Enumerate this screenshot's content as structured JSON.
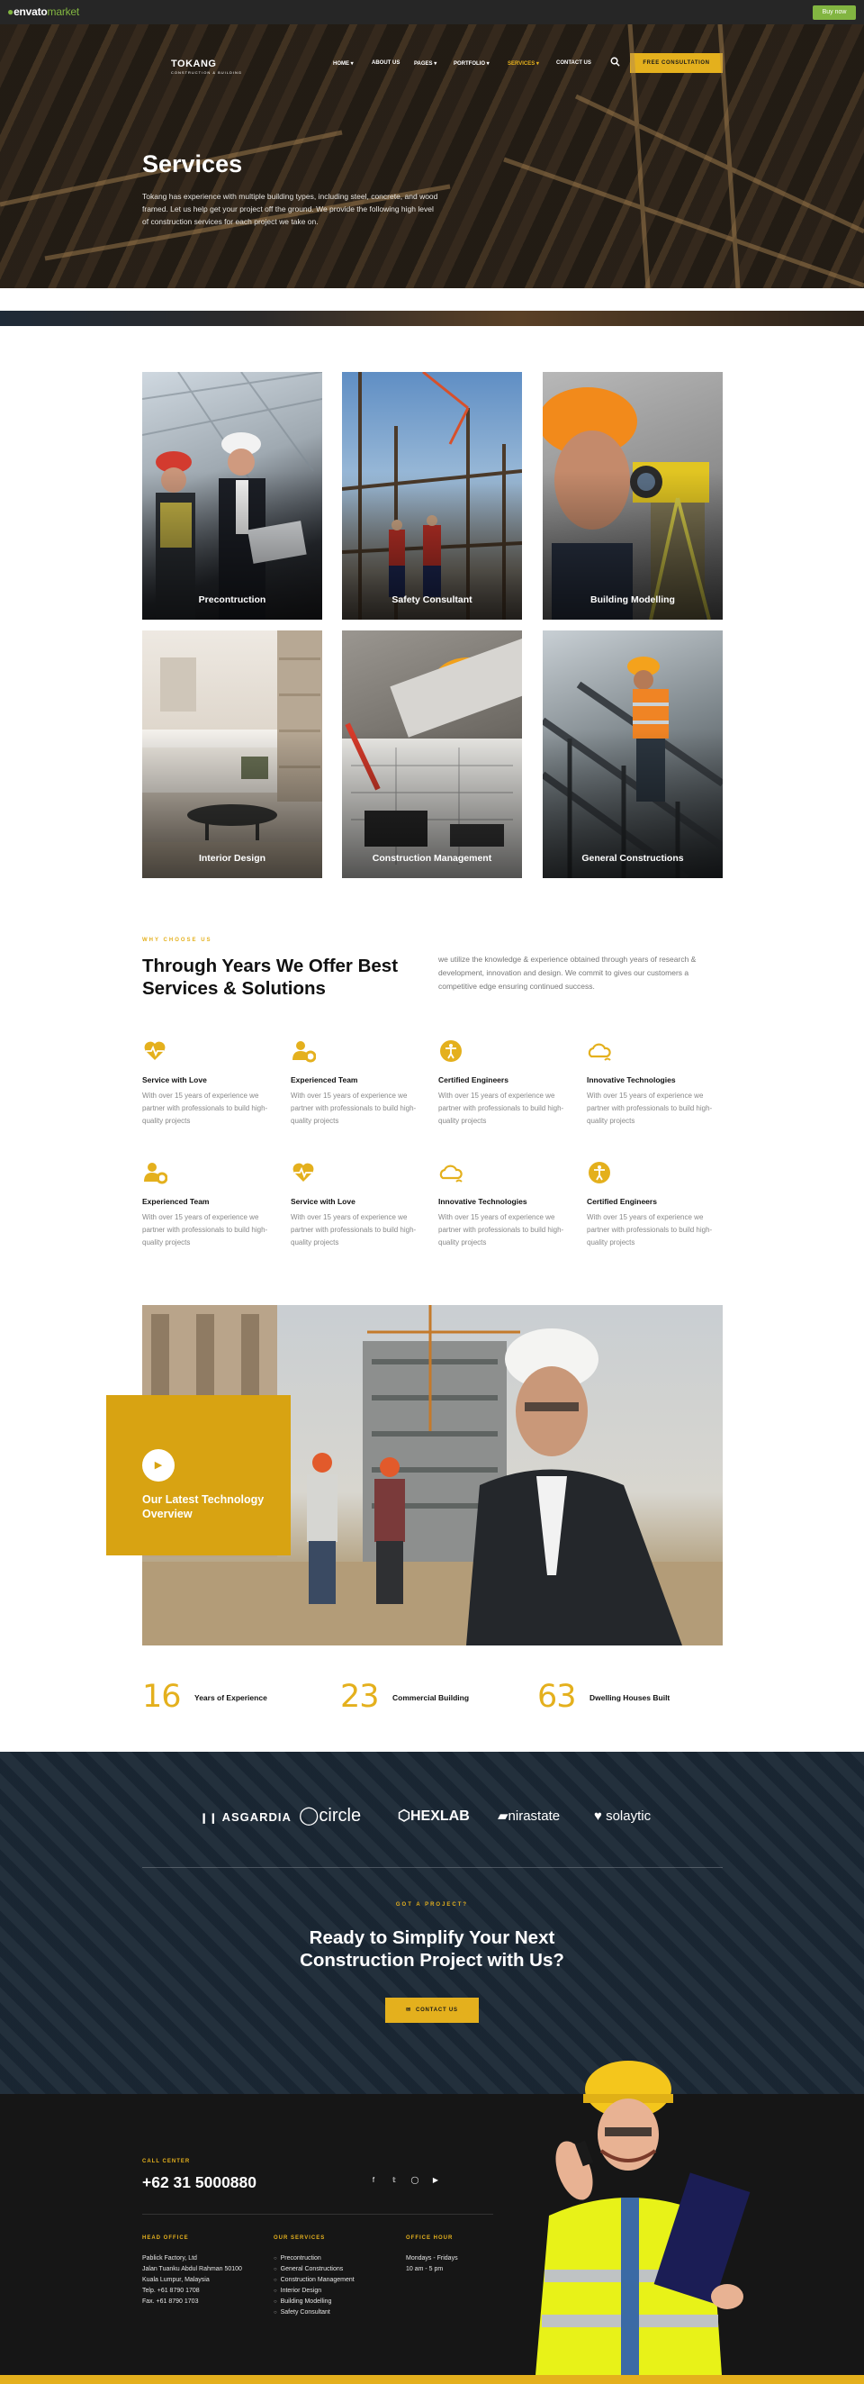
{
  "envato": {
    "logo_main": "envato",
    "logo_suffix": "market",
    "buy_label": "Buy now"
  },
  "header": {
    "brand": "TOKANG",
    "brand_tagline": "CONSTRUCTION & BUILDING",
    "nav": [
      "HOME",
      "ABOUT US",
      "PAGES",
      "PORTFOLIO",
      "SERVICES",
      "CONTACT US"
    ],
    "cta_label": "FREE CONSULTATION",
    "icons": {
      "search": "search-icon",
      "dropdown": "chevron-down-icon"
    }
  },
  "hero": {
    "title": "Services",
    "description": "Tokang has experience with multiple building types, including steel, concrete, and wood framed. Let us help get your project off the ground. We provide the following high level of construction services for each project we take on."
  },
  "services": [
    {
      "label": "Precontruction"
    },
    {
      "label": "Safety Consultant"
    },
    {
      "label": "Building Modelling"
    },
    {
      "label": "Interior Design"
    },
    {
      "label": "Construction Management"
    },
    {
      "label": "General Constructions"
    }
  ],
  "why": {
    "eyebrow": "WHY CHOOSE US",
    "title": "Through Years We Offer Best Services & Solutions",
    "description": "we utilize the knowledge & experience obtained through years of research & development, innovation and design. We commit to gives our customers a competitive edge ensuring continued success.",
    "features": [
      {
        "icon": "heartbeat-icon",
        "title": "Service with Love",
        "text": "With over 15 years of experience we partner with professionals to build high-quality projects"
      },
      {
        "icon": "team-gear-icon",
        "title": "Experienced Team",
        "text": "With over 15 years of experience we partner with professionals to build high-quality projects"
      },
      {
        "icon": "accessibility-icon",
        "title": "Certified Engineers",
        "text": "With over 15 years of experience we partner with professionals to build high-quality projects"
      },
      {
        "icon": "cloud-signal-icon",
        "title": "Innovative Technologies",
        "text": "With over 15 years of experience we partner with professionals to build high-quality projects"
      },
      {
        "icon": "team-gear-icon",
        "title": "Experienced Team",
        "text": "With over 15 years of experience we partner with professionals to build high-quality projects"
      },
      {
        "icon": "heartbeat-icon",
        "title": "Service with Love",
        "text": "With over 15 years of experience we partner with professionals to build high-quality projects"
      },
      {
        "icon": "cloud-signal-icon",
        "title": "Innovative Technologies",
        "text": "With over 15 years of experience we partner with professionals to build high-quality projects"
      },
      {
        "icon": "accessibility-icon",
        "title": "Certified Engineers",
        "text": "With over 15 years of experience we partner with professionals to build high-quality projects"
      }
    ]
  },
  "video": {
    "title": "Our Latest Technology Overview",
    "play_icon": "play-icon"
  },
  "stats": [
    {
      "number": "16",
      "label": "Years of Experience"
    },
    {
      "number": "23",
      "label": "Commercial Building"
    },
    {
      "number": "63",
      "label": "Dwelling Houses Built"
    }
  ],
  "brands": [
    "ASGARDIA",
    "circle",
    "HEXLAB",
    "nirastate",
    "solaytic"
  ],
  "cta": {
    "eyebrow": "GOT A PROJECT?",
    "title": "Ready to Simplify Your Next Construction Project with Us?",
    "button": "CONTACT US"
  },
  "footer": {
    "call_label": "CALL CENTER",
    "call_number": "+62 31 5000880",
    "social_icons": [
      "facebook-icon",
      "twitter-icon",
      "instagram-icon",
      "youtube-icon"
    ],
    "head_office_label": "HEAD OFFICE",
    "head_office_lines": [
      "Pablick Factory, Ltd",
      "Jalan Tuanku Abdul Rahman 50100",
      "Kuala Lumpur, Malaysia",
      "Telp. +61 8790 1708",
      "Fax. +61 8790 1703"
    ],
    "services_label": "OUR SERVICES",
    "services_list": [
      "Precontruction",
      "General Constructions",
      "Construction Management",
      "Interior Design",
      "Building Modelling",
      "Safety Consultant"
    ],
    "hours_label": "OFFICE HOUR",
    "hours_lines": [
      "Mondays - Fridays",
      "10 am - 5 pm"
    ]
  },
  "colors": {
    "accent": "#E4B01D",
    "dark": "#161616",
    "envato_green": "#82B541"
  }
}
